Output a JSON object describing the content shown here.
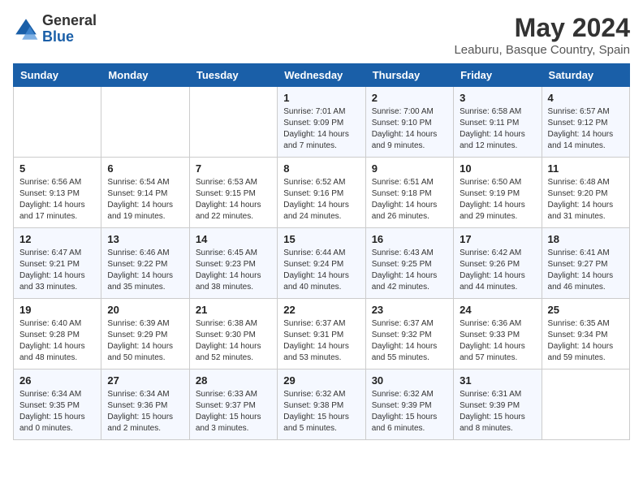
{
  "logo": {
    "general": "General",
    "blue": "Blue"
  },
  "title": "May 2024",
  "subtitle": "Leaburu, Basque Country, Spain",
  "days_header": [
    "Sunday",
    "Monday",
    "Tuesday",
    "Wednesday",
    "Thursday",
    "Friday",
    "Saturday"
  ],
  "weeks": [
    [
      {
        "day": "",
        "info": ""
      },
      {
        "day": "",
        "info": ""
      },
      {
        "day": "",
        "info": ""
      },
      {
        "day": "1",
        "info": "Sunrise: 7:01 AM\nSunset: 9:09 PM\nDaylight: 14 hours\nand 7 minutes."
      },
      {
        "day": "2",
        "info": "Sunrise: 7:00 AM\nSunset: 9:10 PM\nDaylight: 14 hours\nand 9 minutes."
      },
      {
        "day": "3",
        "info": "Sunrise: 6:58 AM\nSunset: 9:11 PM\nDaylight: 14 hours\nand 12 minutes."
      },
      {
        "day": "4",
        "info": "Sunrise: 6:57 AM\nSunset: 9:12 PM\nDaylight: 14 hours\nand 14 minutes."
      }
    ],
    [
      {
        "day": "5",
        "info": "Sunrise: 6:56 AM\nSunset: 9:13 PM\nDaylight: 14 hours\nand 17 minutes."
      },
      {
        "day": "6",
        "info": "Sunrise: 6:54 AM\nSunset: 9:14 PM\nDaylight: 14 hours\nand 19 minutes."
      },
      {
        "day": "7",
        "info": "Sunrise: 6:53 AM\nSunset: 9:15 PM\nDaylight: 14 hours\nand 22 minutes."
      },
      {
        "day": "8",
        "info": "Sunrise: 6:52 AM\nSunset: 9:16 PM\nDaylight: 14 hours\nand 24 minutes."
      },
      {
        "day": "9",
        "info": "Sunrise: 6:51 AM\nSunset: 9:18 PM\nDaylight: 14 hours\nand 26 minutes."
      },
      {
        "day": "10",
        "info": "Sunrise: 6:50 AM\nSunset: 9:19 PM\nDaylight: 14 hours\nand 29 minutes."
      },
      {
        "day": "11",
        "info": "Sunrise: 6:48 AM\nSunset: 9:20 PM\nDaylight: 14 hours\nand 31 minutes."
      }
    ],
    [
      {
        "day": "12",
        "info": "Sunrise: 6:47 AM\nSunset: 9:21 PM\nDaylight: 14 hours\nand 33 minutes."
      },
      {
        "day": "13",
        "info": "Sunrise: 6:46 AM\nSunset: 9:22 PM\nDaylight: 14 hours\nand 35 minutes."
      },
      {
        "day": "14",
        "info": "Sunrise: 6:45 AM\nSunset: 9:23 PM\nDaylight: 14 hours\nand 38 minutes."
      },
      {
        "day": "15",
        "info": "Sunrise: 6:44 AM\nSunset: 9:24 PM\nDaylight: 14 hours\nand 40 minutes."
      },
      {
        "day": "16",
        "info": "Sunrise: 6:43 AM\nSunset: 9:25 PM\nDaylight: 14 hours\nand 42 minutes."
      },
      {
        "day": "17",
        "info": "Sunrise: 6:42 AM\nSunset: 9:26 PM\nDaylight: 14 hours\nand 44 minutes."
      },
      {
        "day": "18",
        "info": "Sunrise: 6:41 AM\nSunset: 9:27 PM\nDaylight: 14 hours\nand 46 minutes."
      }
    ],
    [
      {
        "day": "19",
        "info": "Sunrise: 6:40 AM\nSunset: 9:28 PM\nDaylight: 14 hours\nand 48 minutes."
      },
      {
        "day": "20",
        "info": "Sunrise: 6:39 AM\nSunset: 9:29 PM\nDaylight: 14 hours\nand 50 minutes."
      },
      {
        "day": "21",
        "info": "Sunrise: 6:38 AM\nSunset: 9:30 PM\nDaylight: 14 hours\nand 52 minutes."
      },
      {
        "day": "22",
        "info": "Sunrise: 6:37 AM\nSunset: 9:31 PM\nDaylight: 14 hours\nand 53 minutes."
      },
      {
        "day": "23",
        "info": "Sunrise: 6:37 AM\nSunset: 9:32 PM\nDaylight: 14 hours\nand 55 minutes."
      },
      {
        "day": "24",
        "info": "Sunrise: 6:36 AM\nSunset: 9:33 PM\nDaylight: 14 hours\nand 57 minutes."
      },
      {
        "day": "25",
        "info": "Sunrise: 6:35 AM\nSunset: 9:34 PM\nDaylight: 14 hours\nand 59 minutes."
      }
    ],
    [
      {
        "day": "26",
        "info": "Sunrise: 6:34 AM\nSunset: 9:35 PM\nDaylight: 15 hours\nand 0 minutes."
      },
      {
        "day": "27",
        "info": "Sunrise: 6:34 AM\nSunset: 9:36 PM\nDaylight: 15 hours\nand 2 minutes."
      },
      {
        "day": "28",
        "info": "Sunrise: 6:33 AM\nSunset: 9:37 PM\nDaylight: 15 hours\nand 3 minutes."
      },
      {
        "day": "29",
        "info": "Sunrise: 6:32 AM\nSunset: 9:38 PM\nDaylight: 15 hours\nand 5 minutes."
      },
      {
        "day": "30",
        "info": "Sunrise: 6:32 AM\nSunset: 9:39 PM\nDaylight: 15 hours\nand 6 minutes."
      },
      {
        "day": "31",
        "info": "Sunrise: 6:31 AM\nSunset: 9:39 PM\nDaylight: 15 hours\nand 8 minutes."
      },
      {
        "day": "",
        "info": ""
      }
    ]
  ]
}
